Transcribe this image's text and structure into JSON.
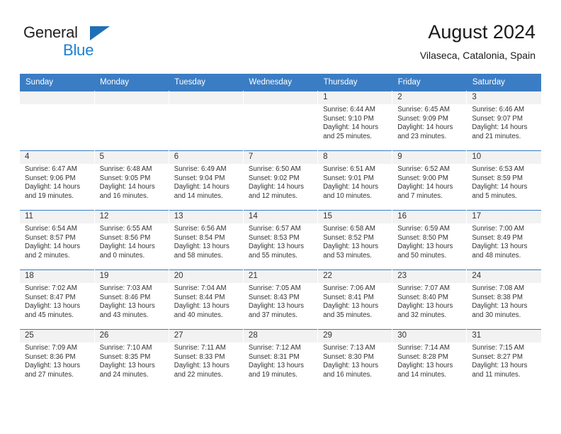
{
  "brand": {
    "line1": "General",
    "line2": "Blue",
    "triangle_color": "#1f6fb6"
  },
  "header": {
    "title": "August 2024",
    "subtitle": "Vilaseca, Catalonia, Spain"
  },
  "theme": {
    "header_blue": "#3b7dc4",
    "daynum_band": "#f2f2f2",
    "text": "#333333"
  },
  "weekday_headers": [
    "Sunday",
    "Monday",
    "Tuesday",
    "Wednesday",
    "Thursday",
    "Friday",
    "Saturday"
  ],
  "weeks": [
    [
      {
        "day": "",
        "empty": true,
        "sunrise": "",
        "sunset": "",
        "daylight1": "",
        "daylight2": ""
      },
      {
        "day": "",
        "empty": true,
        "sunrise": "",
        "sunset": "",
        "daylight1": "",
        "daylight2": ""
      },
      {
        "day": "",
        "empty": true,
        "sunrise": "",
        "sunset": "",
        "daylight1": "",
        "daylight2": ""
      },
      {
        "day": "",
        "empty": true,
        "sunrise": "",
        "sunset": "",
        "daylight1": "",
        "daylight2": ""
      },
      {
        "day": "1",
        "sunrise": "Sunrise: 6:44 AM",
        "sunset": "Sunset: 9:10 PM",
        "daylight1": "Daylight: 14 hours",
        "daylight2": "and 25 minutes."
      },
      {
        "day": "2",
        "sunrise": "Sunrise: 6:45 AM",
        "sunset": "Sunset: 9:09 PM",
        "daylight1": "Daylight: 14 hours",
        "daylight2": "and 23 minutes."
      },
      {
        "day": "3",
        "sunrise": "Sunrise: 6:46 AM",
        "sunset": "Sunset: 9:07 PM",
        "daylight1": "Daylight: 14 hours",
        "daylight2": "and 21 minutes."
      }
    ],
    [
      {
        "day": "4",
        "sunrise": "Sunrise: 6:47 AM",
        "sunset": "Sunset: 9:06 PM",
        "daylight1": "Daylight: 14 hours",
        "daylight2": "and 19 minutes."
      },
      {
        "day": "5",
        "sunrise": "Sunrise: 6:48 AM",
        "sunset": "Sunset: 9:05 PM",
        "daylight1": "Daylight: 14 hours",
        "daylight2": "and 16 minutes."
      },
      {
        "day": "6",
        "sunrise": "Sunrise: 6:49 AM",
        "sunset": "Sunset: 9:04 PM",
        "daylight1": "Daylight: 14 hours",
        "daylight2": "and 14 minutes."
      },
      {
        "day": "7",
        "sunrise": "Sunrise: 6:50 AM",
        "sunset": "Sunset: 9:02 PM",
        "daylight1": "Daylight: 14 hours",
        "daylight2": "and 12 minutes."
      },
      {
        "day": "8",
        "sunrise": "Sunrise: 6:51 AM",
        "sunset": "Sunset: 9:01 PM",
        "daylight1": "Daylight: 14 hours",
        "daylight2": "and 10 minutes."
      },
      {
        "day": "9",
        "sunrise": "Sunrise: 6:52 AM",
        "sunset": "Sunset: 9:00 PM",
        "daylight1": "Daylight: 14 hours",
        "daylight2": "and 7 minutes."
      },
      {
        "day": "10",
        "sunrise": "Sunrise: 6:53 AM",
        "sunset": "Sunset: 8:59 PM",
        "daylight1": "Daylight: 14 hours",
        "daylight2": "and 5 minutes."
      }
    ],
    [
      {
        "day": "11",
        "sunrise": "Sunrise: 6:54 AM",
        "sunset": "Sunset: 8:57 PM",
        "daylight1": "Daylight: 14 hours",
        "daylight2": "and 2 minutes."
      },
      {
        "day": "12",
        "sunrise": "Sunrise: 6:55 AM",
        "sunset": "Sunset: 8:56 PM",
        "daylight1": "Daylight: 14 hours",
        "daylight2": "and 0 minutes."
      },
      {
        "day": "13",
        "sunrise": "Sunrise: 6:56 AM",
        "sunset": "Sunset: 8:54 PM",
        "daylight1": "Daylight: 13 hours",
        "daylight2": "and 58 minutes."
      },
      {
        "day": "14",
        "sunrise": "Sunrise: 6:57 AM",
        "sunset": "Sunset: 8:53 PM",
        "daylight1": "Daylight: 13 hours",
        "daylight2": "and 55 minutes."
      },
      {
        "day": "15",
        "sunrise": "Sunrise: 6:58 AM",
        "sunset": "Sunset: 8:52 PM",
        "daylight1": "Daylight: 13 hours",
        "daylight2": "and 53 minutes."
      },
      {
        "day": "16",
        "sunrise": "Sunrise: 6:59 AM",
        "sunset": "Sunset: 8:50 PM",
        "daylight1": "Daylight: 13 hours",
        "daylight2": "and 50 minutes."
      },
      {
        "day": "17",
        "sunrise": "Sunrise: 7:00 AM",
        "sunset": "Sunset: 8:49 PM",
        "daylight1": "Daylight: 13 hours",
        "daylight2": "and 48 minutes."
      }
    ],
    [
      {
        "day": "18",
        "sunrise": "Sunrise: 7:02 AM",
        "sunset": "Sunset: 8:47 PM",
        "daylight1": "Daylight: 13 hours",
        "daylight2": "and 45 minutes."
      },
      {
        "day": "19",
        "sunrise": "Sunrise: 7:03 AM",
        "sunset": "Sunset: 8:46 PM",
        "daylight1": "Daylight: 13 hours",
        "daylight2": "and 43 minutes."
      },
      {
        "day": "20",
        "sunrise": "Sunrise: 7:04 AM",
        "sunset": "Sunset: 8:44 PM",
        "daylight1": "Daylight: 13 hours",
        "daylight2": "and 40 minutes."
      },
      {
        "day": "21",
        "sunrise": "Sunrise: 7:05 AM",
        "sunset": "Sunset: 8:43 PM",
        "daylight1": "Daylight: 13 hours",
        "daylight2": "and 37 minutes."
      },
      {
        "day": "22",
        "sunrise": "Sunrise: 7:06 AM",
        "sunset": "Sunset: 8:41 PM",
        "daylight1": "Daylight: 13 hours",
        "daylight2": "and 35 minutes."
      },
      {
        "day": "23",
        "sunrise": "Sunrise: 7:07 AM",
        "sunset": "Sunset: 8:40 PM",
        "daylight1": "Daylight: 13 hours",
        "daylight2": "and 32 minutes."
      },
      {
        "day": "24",
        "sunrise": "Sunrise: 7:08 AM",
        "sunset": "Sunset: 8:38 PM",
        "daylight1": "Daylight: 13 hours",
        "daylight2": "and 30 minutes."
      }
    ],
    [
      {
        "day": "25",
        "sunrise": "Sunrise: 7:09 AM",
        "sunset": "Sunset: 8:36 PM",
        "daylight1": "Daylight: 13 hours",
        "daylight2": "and 27 minutes."
      },
      {
        "day": "26",
        "sunrise": "Sunrise: 7:10 AM",
        "sunset": "Sunset: 8:35 PM",
        "daylight1": "Daylight: 13 hours",
        "daylight2": "and 24 minutes."
      },
      {
        "day": "27",
        "sunrise": "Sunrise: 7:11 AM",
        "sunset": "Sunset: 8:33 PM",
        "daylight1": "Daylight: 13 hours",
        "daylight2": "and 22 minutes."
      },
      {
        "day": "28",
        "sunrise": "Sunrise: 7:12 AM",
        "sunset": "Sunset: 8:31 PM",
        "daylight1": "Daylight: 13 hours",
        "daylight2": "and 19 minutes."
      },
      {
        "day": "29",
        "sunrise": "Sunrise: 7:13 AM",
        "sunset": "Sunset: 8:30 PM",
        "daylight1": "Daylight: 13 hours",
        "daylight2": "and 16 minutes."
      },
      {
        "day": "30",
        "sunrise": "Sunrise: 7:14 AM",
        "sunset": "Sunset: 8:28 PM",
        "daylight1": "Daylight: 13 hours",
        "daylight2": "and 14 minutes."
      },
      {
        "day": "31",
        "sunrise": "Sunrise: 7:15 AM",
        "sunset": "Sunset: 8:27 PM",
        "daylight1": "Daylight: 13 hours",
        "daylight2": "and 11 minutes."
      }
    ]
  ]
}
